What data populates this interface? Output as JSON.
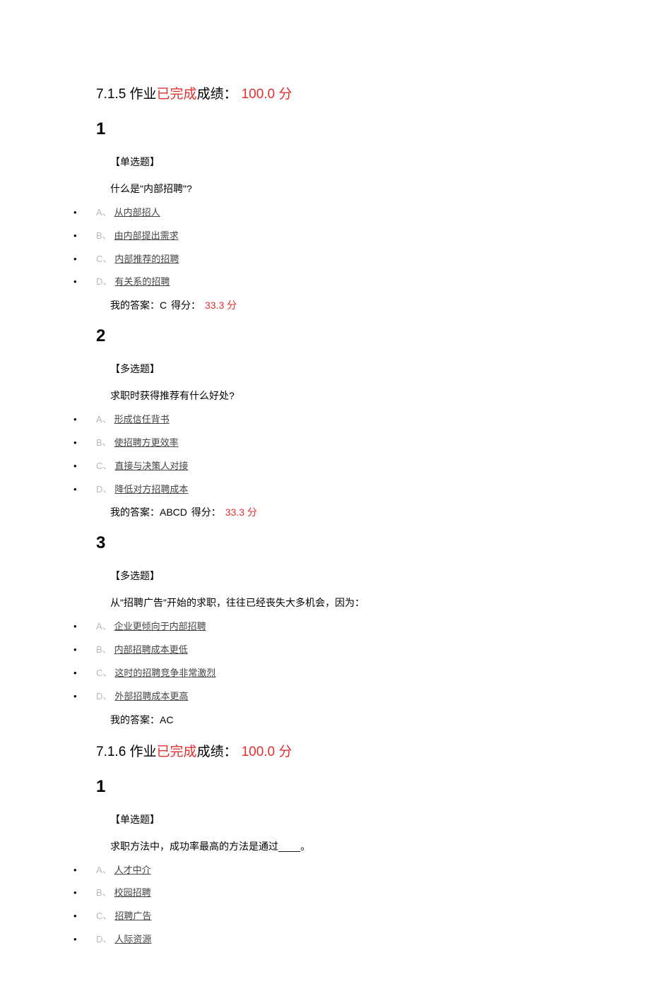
{
  "sections": [
    {
      "header": {
        "homework_num": "7.1.5 作业",
        "completed": "已完成",
        "score_label": "成绩：",
        "score_value": "100.0 分"
      },
      "questions": [
        {
          "num": "1",
          "type": "【单选题】",
          "text": "什么是\"内部招聘\"?",
          "options": [
            {
              "letter": "A、",
              "text": "从内部招人"
            },
            {
              "letter": "B、",
              "text": "由内部提出需求"
            },
            {
              "letter": "C、",
              "text": "内部推荐的招聘"
            },
            {
              "letter": "D、",
              "text": "有关系的招聘"
            }
          ],
          "answer": {
            "label": "我的答案：",
            "value": "C",
            "points_label": "得分：",
            "points_value": "33.3 分"
          }
        },
        {
          "num": "2",
          "type": "【多选题】",
          "text": "求职时获得推荐有什么好处?",
          "options": [
            {
              "letter": "A、",
              "text": "形成信任背书"
            },
            {
              "letter": "B、",
              "text": "使招聘方更效率"
            },
            {
              "letter": "C、",
              "text": "直接与决策人对接"
            },
            {
              "letter": "D、",
              "text": "降低对方招聘成本"
            }
          ],
          "answer": {
            "label": "我的答案：",
            "value": "ABCD",
            "points_label": "得分：",
            "points_value": "33.3 分"
          }
        },
        {
          "num": "3",
          "type": "【多选题】",
          "text": "从\"招聘广告\"开始的求职，往往已经丧失大多机会，因为：",
          "options": [
            {
              "letter": "A、",
              "text": "企业更倾向于内部招聘"
            },
            {
              "letter": "B、",
              "text": "内部招聘成本更低"
            },
            {
              "letter": "C、",
              "text": "这时的招聘竞争非常激烈"
            },
            {
              "letter": "D、",
              "text": "外部招聘成本更高"
            }
          ],
          "answer": {
            "label": "我的答案：",
            "value": "AC",
            "points_label": "",
            "points_value": ""
          }
        }
      ]
    },
    {
      "header": {
        "homework_num": "7.1.6 作业",
        "completed": "已完成",
        "score_label": "成绩：",
        "score_value": "100.0 分"
      },
      "questions": [
        {
          "num": "1",
          "type": "【单选题】",
          "text": "求职方法中，成功率最高的方法是通过____。",
          "options": [
            {
              "letter": "A、",
              "text": "人才中介"
            },
            {
              "letter": "B、",
              "text": "校园招聘"
            },
            {
              "letter": "C、",
              "text": "招聘广告"
            },
            {
              "letter": "D、",
              "text": "人际资源"
            }
          ],
          "answer": null
        }
      ]
    }
  ]
}
